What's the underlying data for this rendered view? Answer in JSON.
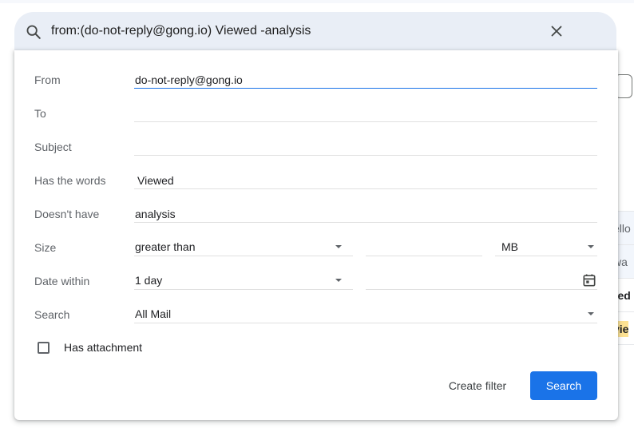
{
  "search": {
    "query": "from:(do-not-reply@gong.io) Viewed -analysis",
    "search_icon": "search-icon",
    "clear_icon": "close-icon"
  },
  "filters": {
    "from": {
      "label": "From",
      "value": "do-not-reply@gong.io"
    },
    "to": {
      "label": "To",
      "value": ""
    },
    "subject": {
      "label": "Subject",
      "value": ""
    },
    "has_words": {
      "label": "Has the words",
      "value": "Viewed"
    },
    "doesnt_have": {
      "label": "Doesn't have",
      "value": "analysis"
    },
    "size": {
      "label": "Size",
      "operator": "greater than",
      "value": "",
      "unit": "MB"
    },
    "date_within": {
      "label": "Date within",
      "value": "1 day",
      "date": "",
      "icon": "calendar-icon"
    },
    "search_in": {
      "label": "Search",
      "value": "All Mail"
    },
    "has_attachment": {
      "label": "Has attachment",
      "checked": false
    }
  },
  "actions": {
    "create_filter": "Create filter",
    "search": "Search"
  },
  "background": {
    "rows": [
      "ello",
      "wa",
      "red",
      "vie"
    ]
  },
  "colors": {
    "accent": "#1a73e8",
    "search_bar_bg": "#e9eef6",
    "highlight": "#fde293"
  }
}
